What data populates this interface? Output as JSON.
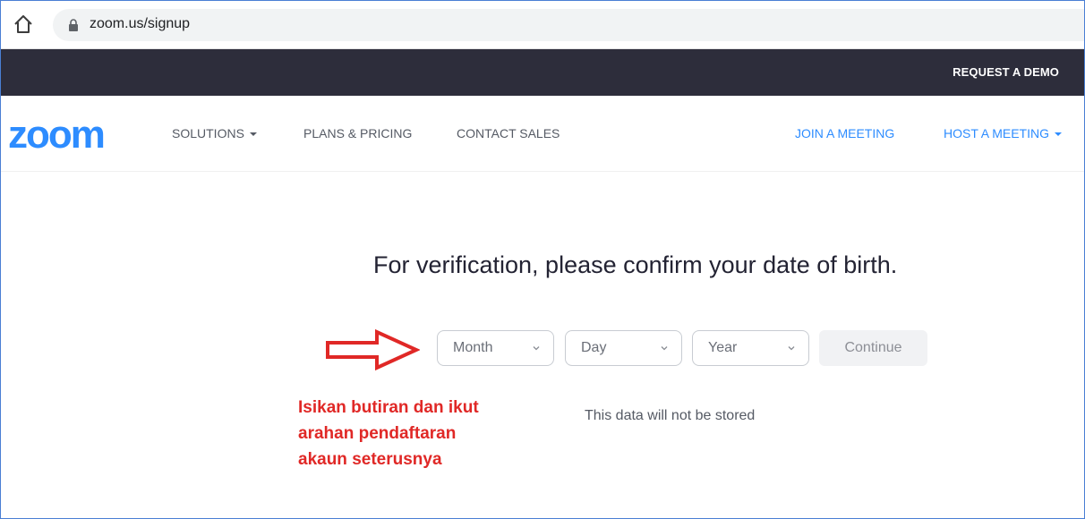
{
  "browser": {
    "url_text": "zoom.us/signup"
  },
  "topbar": {
    "request_demo_label": "REQUEST A DEMO"
  },
  "nav": {
    "logo_text": "zoom",
    "solutions_label": "SOLUTIONS",
    "plans_label": "PLANS & PRICING",
    "contact_label": "CONTACT SALES",
    "join_label": "JOIN A MEETING",
    "host_label": "HOST A MEETING"
  },
  "main": {
    "headline": "For verification, please confirm your date of birth.",
    "month_placeholder": "Month",
    "day_placeholder": "Day",
    "year_placeholder": "Year",
    "continue_label": "Continue",
    "storage_note": "This data will not be stored"
  },
  "annotation": {
    "line1": "Isikan butiran dan ikut",
    "line2": "arahan pendaftaran",
    "line3": "akaun seterusnya"
  },
  "colors": {
    "brand_blue": "#2d8cff",
    "demo_bar": "#2d2d3b",
    "annotation_red": "#e02826"
  },
  "icons": {
    "home": "home-icon",
    "lock": "lock-icon",
    "dropdown": "chevron-down-icon",
    "pointer": "arrow-right-icon"
  }
}
